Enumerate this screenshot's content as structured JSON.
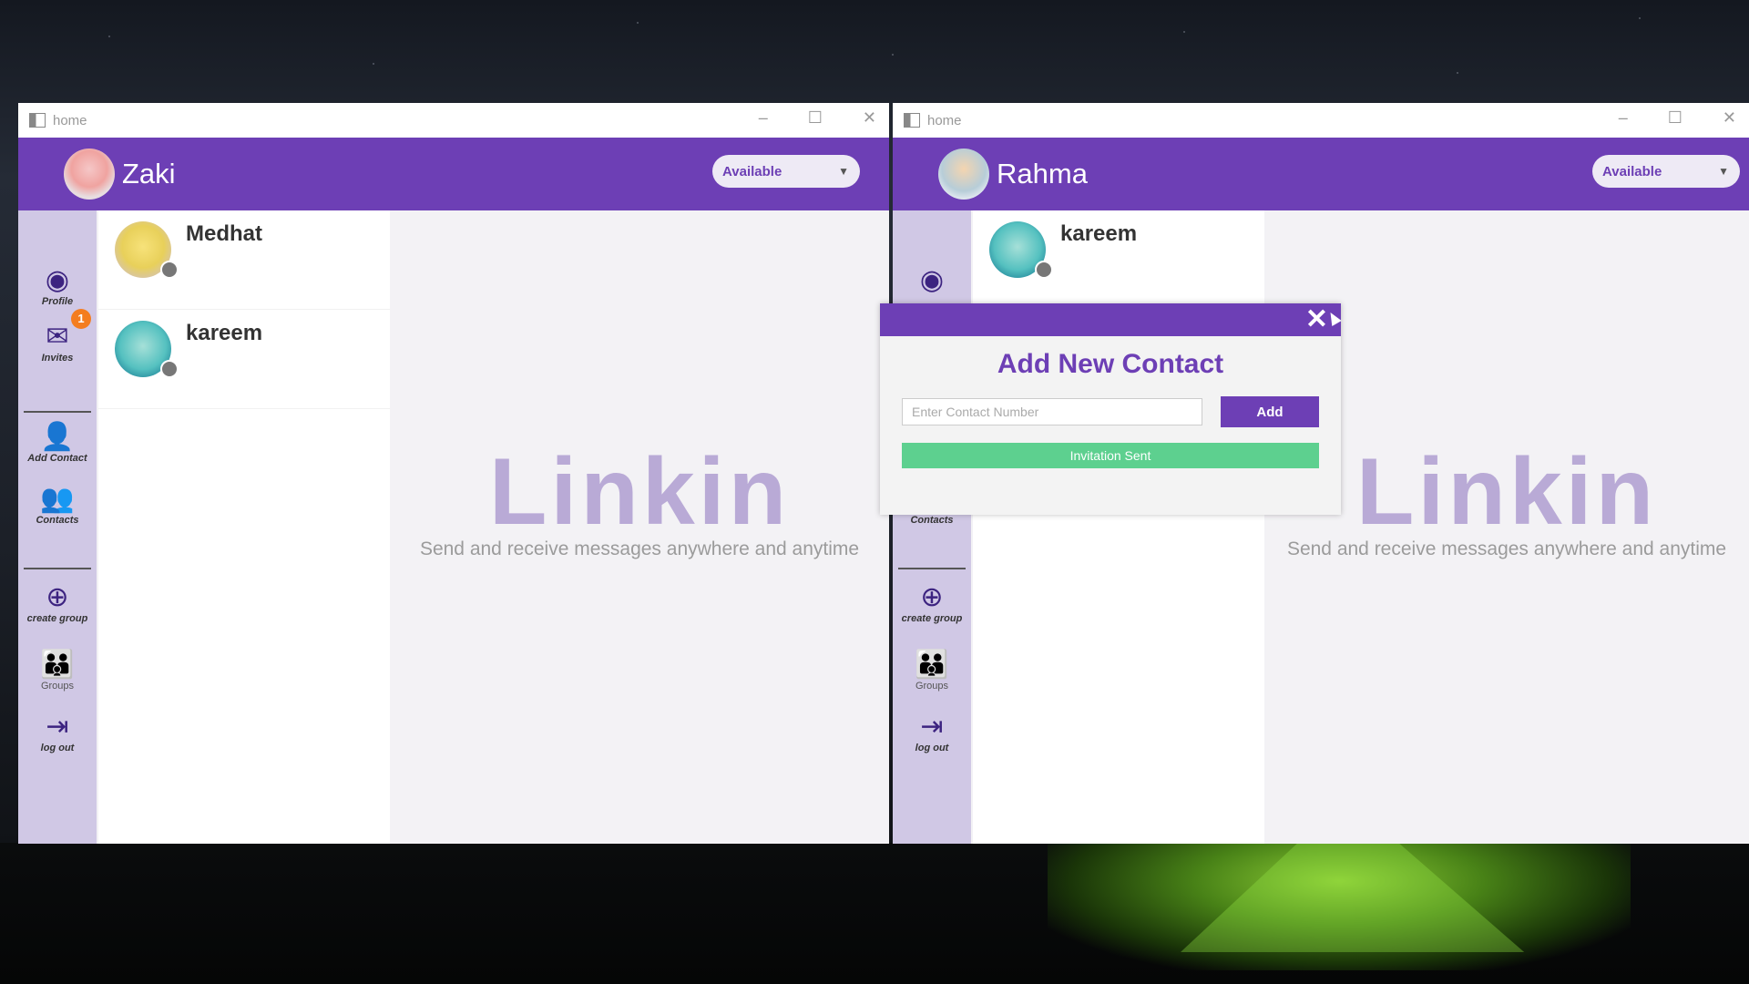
{
  "windows": [
    {
      "title": "home",
      "user": "Zaki",
      "status": "Available",
      "nav": {
        "profile": "Profile",
        "invites": "Invites",
        "invites_badge": "1",
        "add_contact": "Add Contact",
        "contacts": "Contacts",
        "create_group": "create group",
        "groups": "Groups",
        "log_out": "log out"
      },
      "contacts": [
        "Medhat",
        "kareem"
      ],
      "logo": "Linkin",
      "tagline": "Send and receive messages anywhere and anytime"
    },
    {
      "title": "home",
      "user": "Rahma",
      "status": "Available",
      "nav": {
        "contacts": "Contacts",
        "create_group": "create group",
        "groups": "Groups",
        "log_out": "log out"
      },
      "contacts": [
        "kareem"
      ],
      "logo": "Linkin",
      "tagline": "Send and receive messages anywhere and anytime"
    }
  ],
  "modal": {
    "title": "Add New Contact",
    "input_placeholder": "Enter Contact Number",
    "add_label": "Add",
    "message": "Invitation Sent"
  },
  "colors": {
    "brand": "#6d3fb5",
    "sidebar": "#d0c8e5",
    "success": "#5dd08f",
    "badge": "#f47d1f"
  }
}
